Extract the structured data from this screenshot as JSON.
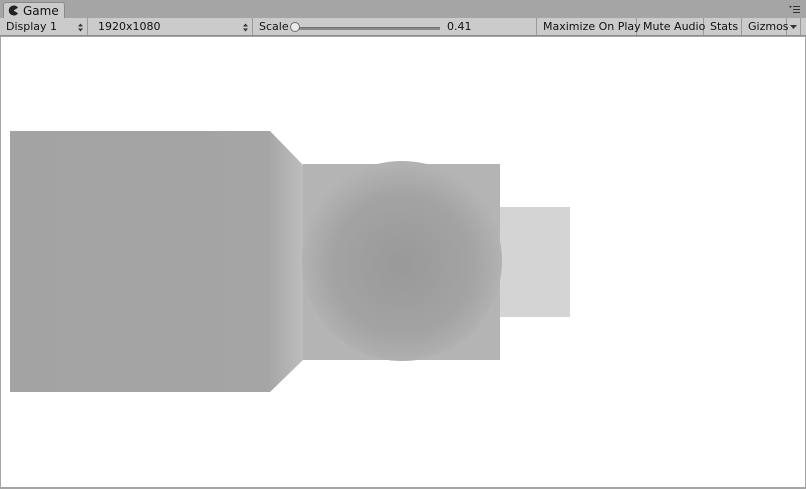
{
  "window": {
    "tab_label": "Game",
    "tab_icon": "pacman-icon",
    "menu_icon": "window-menu-icon"
  },
  "toolbar": {
    "display_label": "Display 1",
    "resolution_label": "1920x1080",
    "scale_label": "Scale",
    "scale_value": "0.41",
    "maximize_label": "Maximize On Play",
    "mute_label": "Mute Audio",
    "stats_label": "Stats",
    "gizmos_label": "Gizmos"
  },
  "colors": {
    "panel": "#cbcbcb",
    "frame": "#a5a5a5",
    "viewport_bg": "#ffffff",
    "large_box": "#a3a3a3",
    "middle_box": "#b4b4b4",
    "sphere": "#9e9e9e",
    "small_box": "#d4d4d4"
  }
}
